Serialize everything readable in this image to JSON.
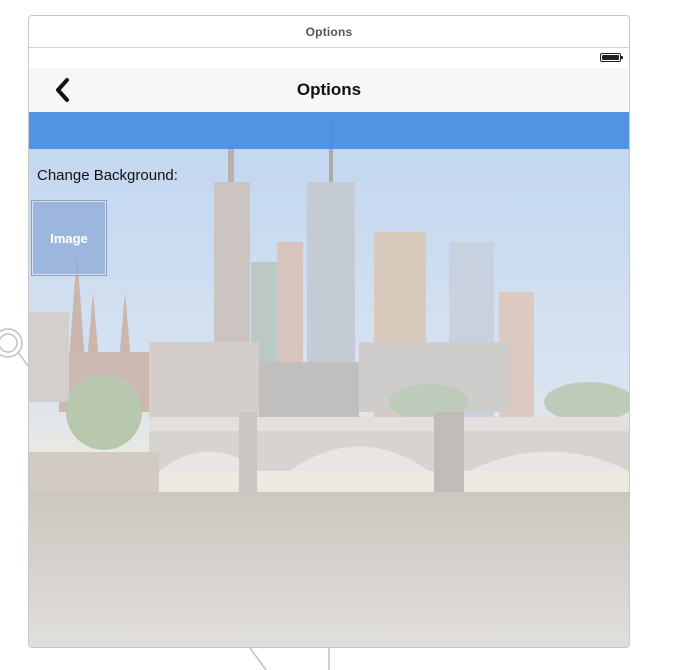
{
  "scene": {
    "title": "Options"
  },
  "status_bar": {
    "battery_icon": "battery-icon"
  },
  "nav_bar": {
    "back_icon": "chevron-left-icon",
    "title": "Options"
  },
  "content": {
    "change_background_label": "Change Background:",
    "image_button_label": "Image",
    "accent_color": "#4a90e2"
  }
}
